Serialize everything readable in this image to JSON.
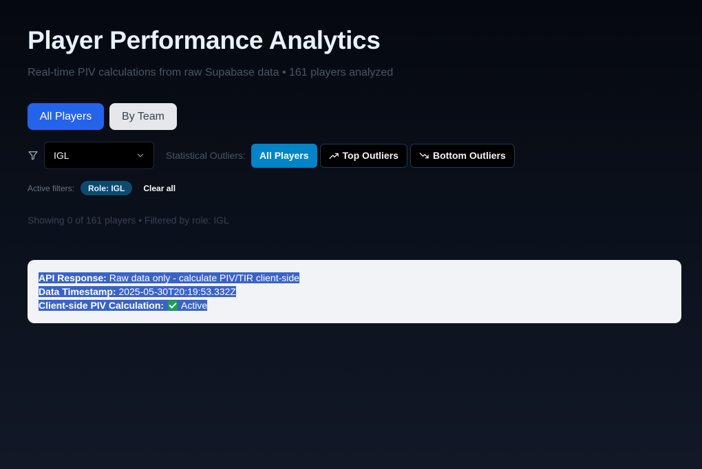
{
  "header": {
    "title": "Player Performance Analytics",
    "subtitle": "Real-time PIV calculations from raw Supabase data • 161 players analyzed"
  },
  "view_toggle": {
    "all_players": "All Players",
    "by_team": "By Team"
  },
  "filters": {
    "filter_icon": "filter-icon",
    "role_select_value": "IGL",
    "outliers_label": "Statistical Outliers:",
    "outlier_buttons": {
      "all": "All Players",
      "top": "Top Outliers",
      "bottom": "Bottom Outliers"
    }
  },
  "active_filters": {
    "label": "Active filters:",
    "chip": "Role: IGL",
    "clear_all": "Clear all"
  },
  "status": {
    "showing": "Showing 0 of 161 players • Filtered by role: IGL"
  },
  "info_card": {
    "api_response_key": "API Response:",
    "api_response_value": "Raw data only - calculate PIV/TIR client-side",
    "timestamp_key": "Data Timestamp:",
    "timestamp_value": "2025-05-30T20:19:53.332Z",
    "piv_key": "Client-side PIV Calculation:",
    "piv_value": "Active",
    "piv_icon": "checkmark-icon"
  },
  "colors": {
    "primary": "#2563eb",
    "outlier_active": "#0284c7",
    "chip": "#0c4a6e",
    "selection": "#3a63c8",
    "check": "#16a34a"
  }
}
